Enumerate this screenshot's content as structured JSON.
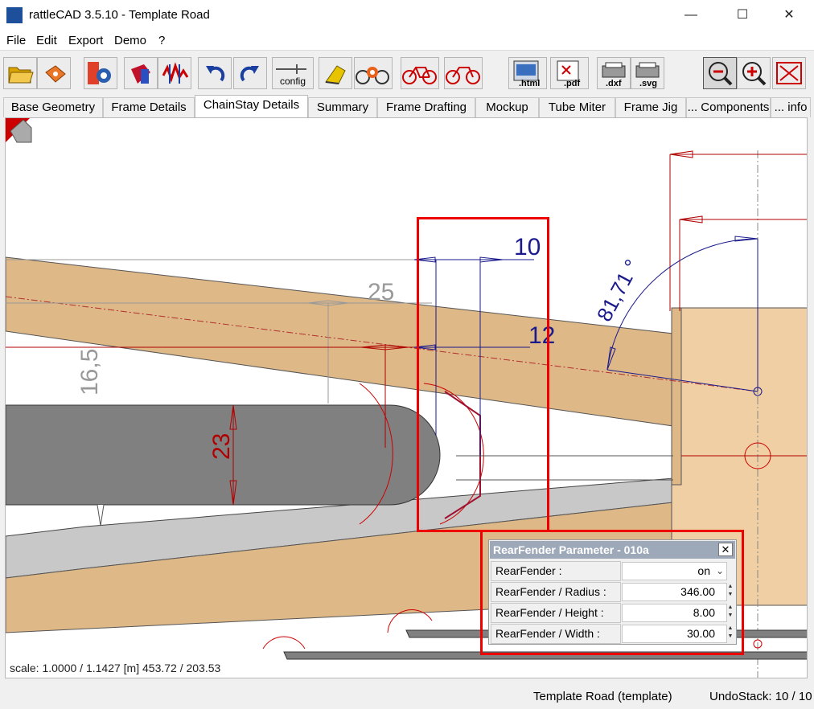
{
  "window": {
    "title": "rattleCAD  3.5.10 - Template Road",
    "controls": {
      "minimize": "—",
      "maximize": "☐",
      "close": "✕"
    }
  },
  "menu": [
    "File",
    "Edit",
    "Export",
    "Demo",
    "?"
  ],
  "toolbar": {
    "buttons": [
      {
        "icon": "open-folder-icon"
      },
      {
        "icon": "save-icon"
      },
      {
        "icon": "settings-icon"
      },
      {
        "icon": "tube-icon"
      },
      {
        "icon": "compare-icon"
      },
      {
        "icon": "undo-icon"
      },
      {
        "icon": "redo-icon"
      },
      {
        "icon": "config-icon",
        "label": "config"
      },
      {
        "icon": "render-icon"
      },
      {
        "icon": "bike-settings-icon"
      },
      {
        "icon": "bike-red-icon"
      },
      {
        "icon": "bike-outline-icon"
      },
      {
        "icon": "export-html-icon",
        "label": ".html"
      },
      {
        "icon": "export-pdf-icon",
        "label": ".pdf"
      },
      {
        "icon": "export-dxf-icon",
        "label": ".dxf"
      },
      {
        "icon": "export-svg-icon",
        "label": ".svg"
      },
      {
        "icon": "zoom-out-icon"
      },
      {
        "icon": "zoom-in-icon"
      },
      {
        "icon": "zoom-fit-icon"
      }
    ]
  },
  "tabs": [
    "Base Geometry",
    "Frame Details",
    "ChainStay Details",
    "Summary",
    "Frame Drafting",
    "Mockup",
    "Tube Miter",
    "Frame Jig",
    "... Components",
    "... info"
  ],
  "active_tab": "ChainStay Details",
  "drawing": {
    "dimensions": {
      "d10": "10",
      "d25": "25",
      "d12": "12",
      "d16_5": "16,5",
      "d23": "23",
      "angle": "81,71 °"
    },
    "colors": {
      "tube": "#deb887",
      "tube_light": "#f0cfa5",
      "gray": "#808080",
      "dimension_blue": "#1a1a8c",
      "dimension_red": "#b00000"
    }
  },
  "scale_text": "scale: 1.0000 / 1.1427  [m]  453.72 / 203.53",
  "dialog": {
    "title": "RearFender Parameter - 010a",
    "close": "✕",
    "params": [
      {
        "label": "RearFender  :",
        "value": "on",
        "kind": "dropdown"
      },
      {
        "label": "RearFender / Radius  :",
        "value": "346.00",
        "kind": "spin"
      },
      {
        "label": "RearFender / Height  :",
        "value": "8.00",
        "kind": "spin"
      },
      {
        "label": "RearFender / Width  :",
        "value": "30.00",
        "kind": "spin"
      }
    ]
  },
  "status": {
    "left": "Template Road (template)",
    "right": "UndoStack: 10 / 10"
  }
}
